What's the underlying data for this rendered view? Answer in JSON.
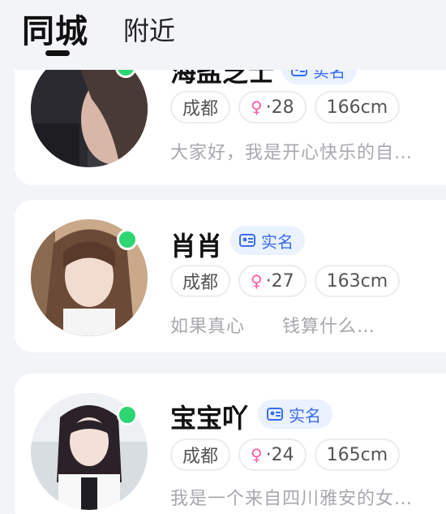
{
  "tabs": {
    "active": "同城",
    "other": "附近"
  },
  "colors": {
    "accent_online": "#2ed573",
    "verify_bg": "#eaf1ff",
    "verify_text": "#3a6df0",
    "female_icon": "#ff5aa5"
  },
  "cards": [
    {
      "name": "海盐芝士",
      "verify": "实名",
      "city": "成都",
      "gender_symbol": "♀",
      "age": "·28",
      "height": "166cm",
      "bio": "大家好，我是开心快乐的自…"
    },
    {
      "name": "肖肖",
      "verify": "实名",
      "city": "成都",
      "gender_symbol": "♀",
      "age": "·27",
      "height": "163cm",
      "bio": "如果真心　　钱算什么…"
    },
    {
      "name": "宝宝吖",
      "verify": "实名",
      "city": "成都",
      "gender_symbol": "♀",
      "age": "·24",
      "height": "165cm",
      "bio": "我是一个来自四川雅安的女…"
    }
  ]
}
